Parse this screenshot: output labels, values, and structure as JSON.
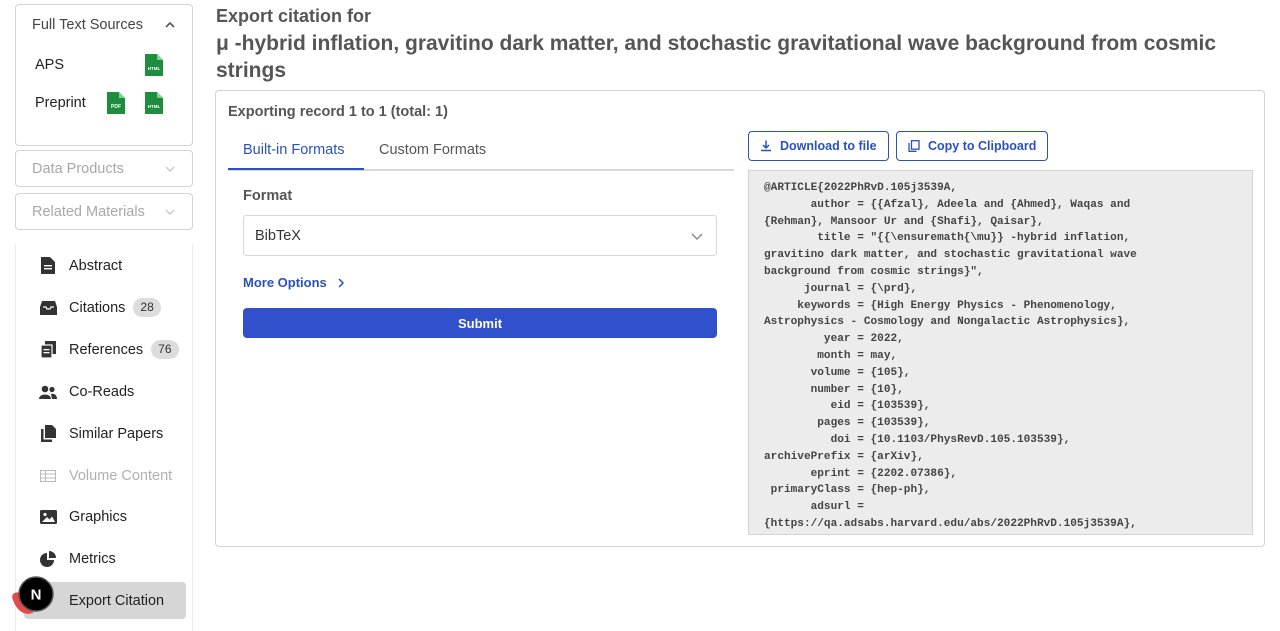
{
  "sidebar": {
    "full_text": {
      "header": "Full Text Sources",
      "sources": [
        {
          "label": "APS",
          "files": [
            "HTML"
          ]
        },
        {
          "label": "Preprint",
          "files": [
            "PDF",
            "HTML"
          ]
        }
      ]
    },
    "data_products": "Data Products",
    "related_materials": "Related Materials",
    "nav": [
      {
        "label": "Abstract",
        "icon": "document-icon"
      },
      {
        "label": "Citations",
        "icon": "inbox-icon",
        "badge": "28"
      },
      {
        "label": "References",
        "icon": "copy-icon",
        "badge": "76"
      },
      {
        "label": "Co-Reads",
        "icon": "users-icon"
      },
      {
        "label": "Similar Papers",
        "icon": "files-icon"
      },
      {
        "label": "Volume Content",
        "icon": "table-icon"
      },
      {
        "label": "Graphics",
        "icon": "image-icon"
      },
      {
        "label": "Metrics",
        "icon": "pie-chart-icon"
      },
      {
        "label": "Export Citation",
        "icon": "external-link-icon"
      }
    ]
  },
  "main": {
    "export_for": "Export citation for",
    "paper_title": "μ -hybrid inflation, gravitino dark matter, and stochastic gravitational wave background from cosmic strings",
    "exporting": "Exporting record 1 to 1 (total: 1)",
    "tabs": [
      "Built-in Formats",
      "Custom Formats"
    ],
    "format_label": "Format",
    "format_value": "BibTeX",
    "more_options": "More Options",
    "submit": "Submit",
    "download": "Download to file",
    "copy": "Copy to Clipboard",
    "citation_lines": [
      "@ARTICLE{2022PhRvD.105j3539A,",
      "       author = {{Afzal}, Adeela and {Ahmed}, Waqas and",
      "{Rehman}, Mansoor Ur and {Shafi}, Qaisar},",
      "        title = \"{{\\ensuremath{\\mu}} -hybrid inflation,",
      "gravitino dark matter, and stochastic gravitational wave",
      "background from cosmic strings}\",",
      "      journal = {\\prd},",
      "     keywords = {High Energy Physics - Phenomenology,",
      "Astrophysics - Cosmology and Nongalactic Astrophysics},",
      "         year = 2022,",
      "        month = may,",
      "       volume = {105},",
      "       number = {10},",
      "          eid = {103539},",
      "        pages = {103539},",
      "          doi = {10.1103/PhysRevD.105.103539},",
      "archivePrefix = {arXiv},",
      "       eprint = {2202.07386},",
      " primaryClass = {hep-ph},",
      "       adsurl =",
      "{https://qa.adsabs.harvard.edu/abs/2022PhRvD.105j3539A},"
    ]
  },
  "colors": {
    "accent": "#2a52be",
    "submit": "#3050cc",
    "file_icon": "#1e8e3e"
  }
}
